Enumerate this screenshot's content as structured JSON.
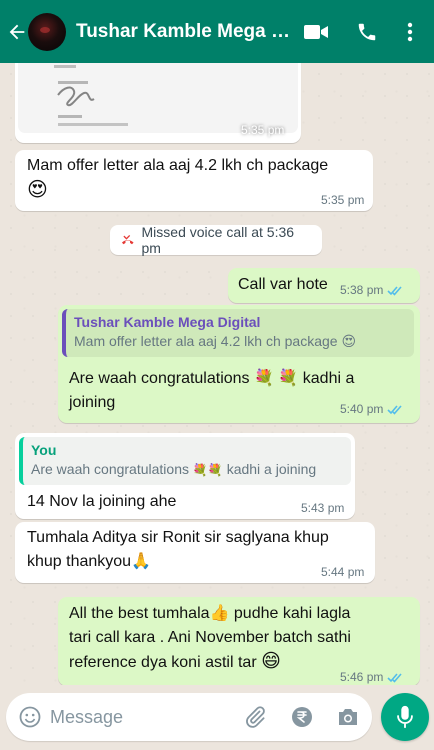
{
  "header": {
    "title": "Tushar Kamble Mega D...",
    "icons": [
      "back-arrow-icon",
      "video-call-icon",
      "phone-call-icon",
      "more-options-icon"
    ]
  },
  "messages": {
    "image": {
      "time": "5:35 pm",
      "text": ""
    },
    "m1": {
      "text": "Mam offer letter ala aaj 4.2 lkh ch package",
      "emoji": "😍",
      "time": "5:35 pm"
    },
    "missed_call": {
      "text": "Missed voice call at 5:36 pm"
    },
    "m2": {
      "text": "Call var hote",
      "time": "5:38 pm"
    },
    "m3": {
      "quote_name": "Tushar Kamble Mega Digital",
      "quote_text": "Mam offer letter ala aaj 4.2 lkh ch package",
      "quote_emoji": "😍",
      "line1": "Are waah  congratulations",
      "emoji1": "💐",
      "emoji2": "💐",
      "line1b": "kadhi a",
      "line2": "joining",
      "time": "5:40 pm"
    },
    "m4": {
      "quote_name": "You",
      "quote_text": "Are waah  congratulations",
      "quote_emoji1": "💐",
      "quote_emoji2": "💐",
      "quote_text_b": "kadhi a joining",
      "text": "14 Nov la joining  ahe",
      "time": "5:43 pm"
    },
    "m5": {
      "line1": "Tumhala Aditya sir Ronit sir saglyana khup",
      "line2": "khup thankyou",
      "emoji": "🙏",
      "time": "5:44 pm"
    },
    "m6": {
      "line1a": "All the best tumhala",
      "emoji1": "👍",
      "line1b": " pudhe kahi lagla",
      "line2": "tari call kara . Ani November batch sathi",
      "line3": "reference dya koni astil tar",
      "emoji2": "😄",
      "time": "5:46 pm"
    }
  },
  "input": {
    "placeholder": "Message",
    "icons": [
      "emoji-icon",
      "attach-icon",
      "rupee-payment-icon",
      "camera-icon",
      "microphone-icon"
    ]
  },
  "colors": {
    "header": "#008069",
    "outgoing_bubble": "#dcf8c6",
    "incoming_bubble": "#ffffff",
    "read_ticks": "#53bdeb",
    "quote_contact": "#6b4fbb",
    "quote_you": "#06cf9c",
    "mic_button": "#00a884"
  }
}
